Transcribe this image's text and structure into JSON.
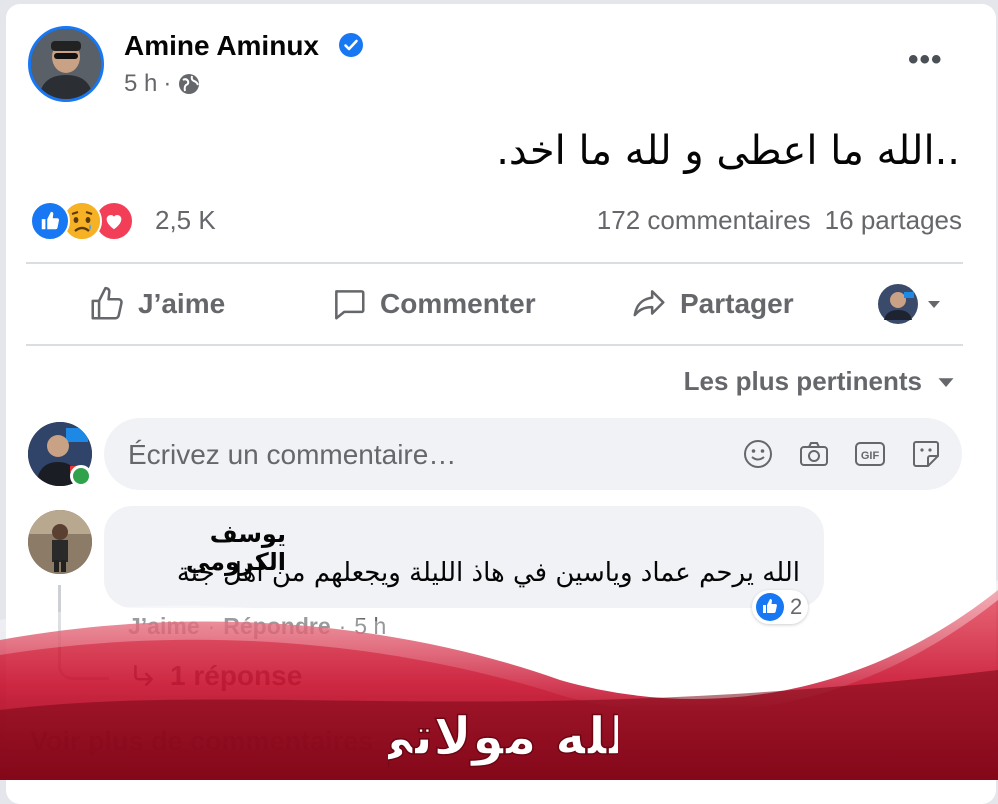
{
  "post": {
    "author": "Amine Aminux",
    "time": "5 h",
    "separator": "·",
    "text": "..الله ما اعطى و لله ما اخد.",
    "reaction_count": "2,5 K",
    "comments_count": "172 commentaires",
    "shares_count": "16 partages"
  },
  "actions": {
    "like": "J’aime",
    "comment": "Commenter",
    "share": "Partager"
  },
  "sort_label": "Les plus pertinents",
  "comment_input": {
    "placeholder": "Écrivez un commentaire…"
  },
  "comment": {
    "author": "يوسف الكرومي",
    "text": "الله يرحم عماد وياسين في هاذ الليلة ويجعلهم من اهل جنة",
    "like_label": "J’aime",
    "reply_label": "Répondre",
    "time": "5 h",
    "dot": "·",
    "reaction_count": "2"
  },
  "replies_label": "1 réponse",
  "view_more_label": "Voir plus de commentaires",
  "watermark_text": "الله مولاتي",
  "colors": {
    "brand_blue": "#1877f2",
    "text_secondary": "#65676b",
    "banner_red": "#c8102e"
  }
}
